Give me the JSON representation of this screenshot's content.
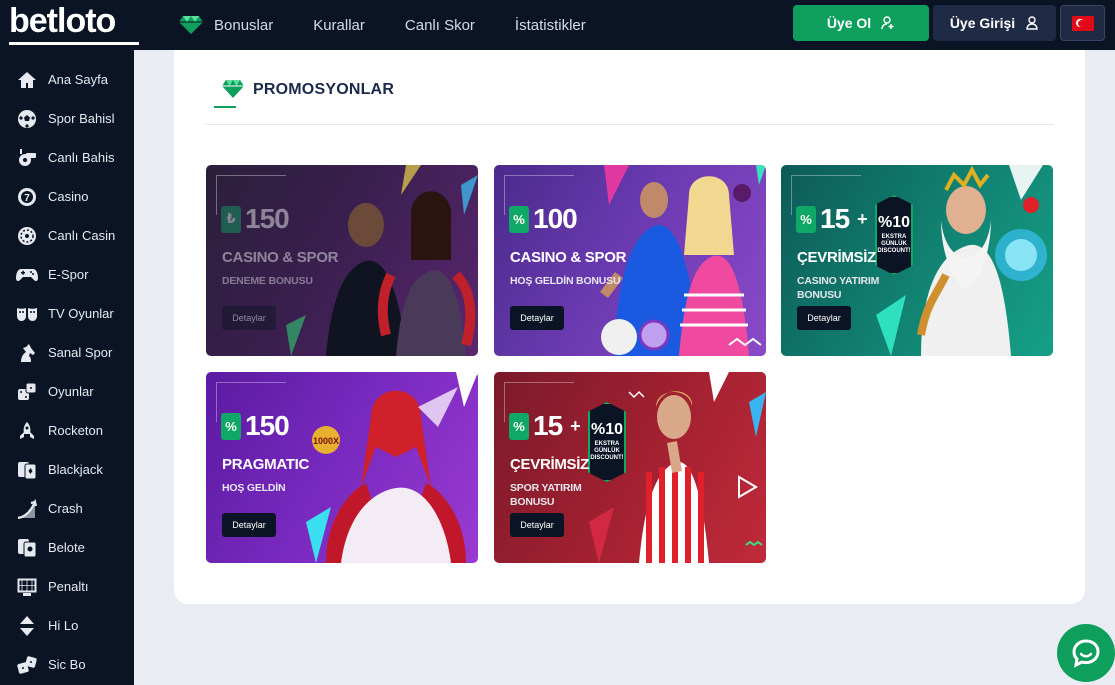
{
  "brand": {
    "logo_text": "betloto"
  },
  "header": {
    "nav": [
      {
        "label": "Bonuslar",
        "icon": "diamond-icon"
      },
      {
        "label": "Kurallar"
      },
      {
        "label": "Canlı Skor"
      },
      {
        "label": "İstatistikler"
      }
    ],
    "register_label": "Üye Ol",
    "login_label": "Üye Girişi",
    "language_flag": "turkey-flag-icon"
  },
  "sidebar": {
    "items": [
      {
        "label": "Ana Sayfa",
        "icon": "home-icon"
      },
      {
        "label": "Spor Bahisl",
        "icon": "soccer-ball-icon"
      },
      {
        "label": "Canlı Bahis",
        "icon": "whistle-icon"
      },
      {
        "label": "Casino",
        "icon": "casino-chip-icon"
      },
      {
        "label": "Canlı Casin",
        "icon": "roulette-icon"
      },
      {
        "label": "E-Spor",
        "icon": "gamepad-icon"
      },
      {
        "label": "TV Oyunlar",
        "icon": "mask-icon"
      },
      {
        "label": "Sanal Spor",
        "icon": "horse-icon"
      },
      {
        "label": "Oyunlar",
        "icon": "dice-icon"
      },
      {
        "label": "Rocketon",
        "icon": "rocket-icon"
      },
      {
        "label": "Blackjack",
        "icon": "cards-icon"
      },
      {
        "label": "Crash",
        "icon": "crash-chart-icon"
      },
      {
        "label": "Belote",
        "icon": "playing-cards-icon"
      },
      {
        "label": "Penaltı",
        "icon": "goal-icon"
      },
      {
        "label": "Hi Lo",
        "icon": "up-down-arrows-icon"
      },
      {
        "label": "Sic Bo",
        "icon": "dice-pair-icon"
      }
    ]
  },
  "main": {
    "title": "PROMOSYONLAR",
    "cards": [
      {
        "symbol": "₺",
        "amount": "150",
        "headline": "CASINO & SPOR",
        "sub": "DENEME BONUSU",
        "button": "Detaylar"
      },
      {
        "symbol": "%",
        "amount": "100",
        "headline": "CASINO & SPOR",
        "sub": "HOŞ GELDİN BONUSU",
        "button": "Detaylar"
      },
      {
        "symbol": "%",
        "amount": "15",
        "plus": "+",
        "headline": "ÇEVRİMSİZ",
        "sub": "CASINO YATIRIM\nBONUSU",
        "button": "Detaylar",
        "discount_big": "%10",
        "discount_small": "EKSTRA\nGÜNLÜK\nDISCOUNT!"
      },
      {
        "symbol": "%",
        "amount": "150",
        "headline": "PRAGMATIC",
        "sub": "HOŞ GELDİN",
        "button": "Detaylar",
        "art_label": "1000X"
      },
      {
        "symbol": "%",
        "amount": "15",
        "plus": "+",
        "headline": "ÇEVRİMSİZ",
        "sub": "SPOR YATIRIM\nBONUSU",
        "button": "Detaylar",
        "discount_big": "%10",
        "discount_small": "EKSTRA\nGÜNLÜK\nDISCOUNT!"
      }
    ]
  },
  "colors": {
    "dark": "#0b1424",
    "accent_green": "#0e9f5c",
    "page_bg": "#e9ecf2"
  }
}
